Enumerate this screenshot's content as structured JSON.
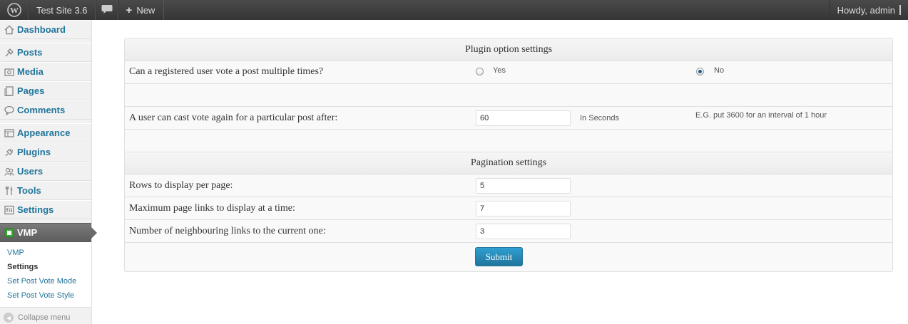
{
  "adminbar": {
    "site_name": "Test Site 3.6",
    "new_label": "New",
    "howdy": "Howdy, admin"
  },
  "sidebar": {
    "items": [
      {
        "label": "Dashboard",
        "icon": "dashboard-icon"
      },
      {
        "label": "Posts",
        "icon": "posts-icon"
      },
      {
        "label": "Media",
        "icon": "media-icon"
      },
      {
        "label": "Pages",
        "icon": "pages-icon"
      },
      {
        "label": "Comments",
        "icon": "comments-icon"
      },
      {
        "label": "Appearance",
        "icon": "appearance-icon"
      },
      {
        "label": "Plugins",
        "icon": "plugins-icon"
      },
      {
        "label": "Users",
        "icon": "users-icon"
      },
      {
        "label": "Tools",
        "icon": "tools-icon"
      },
      {
        "label": "Settings",
        "icon": "settings-icon"
      },
      {
        "label": "VMP",
        "icon": "vmp-icon"
      }
    ],
    "submenu": [
      {
        "label": "VMP"
      },
      {
        "label": "Settings"
      },
      {
        "label": "Set Post Vote Mode"
      },
      {
        "label": "Set Post Vote Style"
      }
    ],
    "collapse_label": "Collapse menu"
  },
  "panel": {
    "plugin_header": "Plugin option settings",
    "multi_vote_label": "Can a registered user vote a post multiple times?",
    "multi_vote_options": {
      "yes": "Yes",
      "no": "No",
      "selected": "No"
    },
    "revote_label": "A user can cast vote again for a particular post after:",
    "revote_value": "60",
    "revote_unit": "In Seconds",
    "revote_hint": "E.G. put 3600 for an interval of 1 hour",
    "pagination_header": "Pagination settings",
    "rows_label": "Rows to display per page:",
    "rows_value": "5",
    "max_links_label": "Maximum page links to display at a time:",
    "max_links_value": "7",
    "neighbour_label": "Number of neighbouring links to the current one:",
    "neighbour_value": "3",
    "submit_label": "Submit"
  },
  "colors": {
    "accent": "#21759b",
    "adminbar": "#464646",
    "active_menu": "#6a6a6a"
  }
}
